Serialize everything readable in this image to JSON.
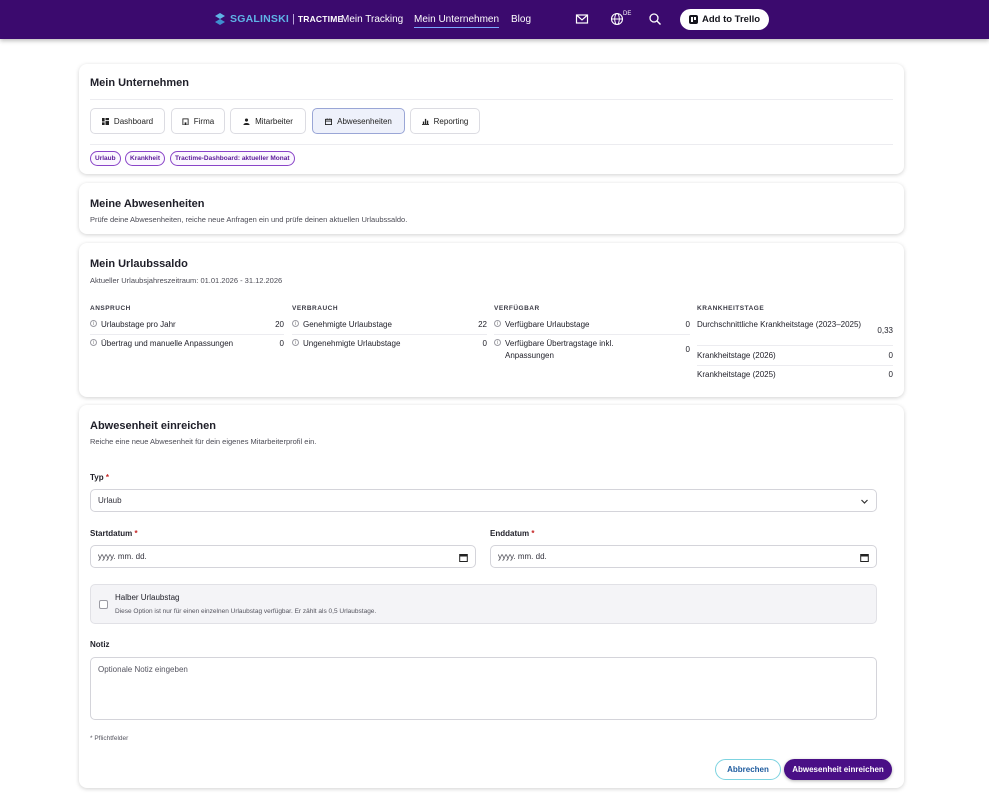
{
  "nav": {
    "brand_primary": "SGALINSKI",
    "brand_separator": "|",
    "brand_secondary": "TRACTIME",
    "links": [
      "Mein Tracking",
      "Mein Unternehmen",
      "Blog"
    ],
    "active_link": "Mein Unternehmen",
    "language_badge": "DE",
    "trello_button": "Add to Trello",
    "colors": {
      "bar": "#3b0a6e",
      "active_underline": "#7aa7ff",
      "brand_accent": "#5fb3e6"
    }
  },
  "company_card": {
    "title": "Mein Unternehmen",
    "tabs": [
      {
        "label": "Dashboard",
        "icon": "dashboard-icon"
      },
      {
        "label": "Firma",
        "icon": "building-icon"
      },
      {
        "label": "Mitarbeiter",
        "icon": "person-icon"
      },
      {
        "label": "Abwesenheiten",
        "icon": "calendar-icon",
        "active": true
      },
      {
        "label": "Reporting",
        "icon": "bar-chart-icon"
      }
    ],
    "chips": [
      "Urlaub",
      "Krankheit",
      "Tractime-Dashboard: aktueller Monat"
    ]
  },
  "absences_card": {
    "title": "Meine Abwesenheiten",
    "subtitle": "Prüfe deine Abwesenheiten, reiche neue Anfragen ein und prüfe deinen aktuellen Urlaubssaldo."
  },
  "saldo_card": {
    "title": "Mein Urlaubssaldo",
    "subtitle": "Aktueller Urlaubsjahreszeitraum: 01.01.2026 - 31.12.2026",
    "columns": [
      {
        "heading": "ANSPRUCH",
        "rows": [
          {
            "label": "Urlaubstage pro Jahr",
            "value": "20",
            "info": true
          },
          {
            "label": "Übertrag und manuelle Anpassungen",
            "value": "0",
            "info": true
          }
        ]
      },
      {
        "heading": "VERBRAUCH",
        "rows": [
          {
            "label": "Genehmigte Urlaubstage",
            "value": "22",
            "info": true
          },
          {
            "label": "Ungenehmigte Urlaubstage",
            "value": "0",
            "info": true
          }
        ]
      },
      {
        "heading": "VERFÜGBAR",
        "rows": [
          {
            "label": "Verfügbare Urlaubstage",
            "value": "0",
            "info": true
          },
          {
            "label": "Verfügbare Übertragstage inkl. Anpassungen",
            "value": "0",
            "info": true
          }
        ]
      },
      {
        "heading": "KRANKHEITSTAGE",
        "rows": [
          {
            "label": "Durchschnittliche Krankheitstage (2023–2025)",
            "value": "0,33",
            "info": false
          },
          {
            "label": "Krankheitstage (2026)",
            "value": "0",
            "info": false
          },
          {
            "label": "Krankheitstage (2025)",
            "value": "0",
            "info": false
          }
        ]
      }
    ]
  },
  "form": {
    "title": "Abwesenheit einreichen",
    "subtitle": "Reiche eine neue Abwesenheit für dein eigenes Mitarbeiterprofil ein.",
    "type_label": "Typ",
    "type_value": "Urlaub",
    "required_mark": "*",
    "start_label": "Startdatum",
    "start_placeholder": "yyyy. mm. dd.",
    "end_label": "Enddatum",
    "end_placeholder": "yyyy. mm. dd.",
    "halfday_title": "Halber Urlaubstag",
    "halfday_hint": "Diese Option ist nur für einen einzelnen Urlaubstag verfügbar. Er zählt als 0,5 Urlaubstage.",
    "note_label": "Notiz",
    "note_placeholder": "Optionale Notiz eingeben",
    "footnote": "* Pflichtfelder",
    "cancel_button": "Abbrechen",
    "submit_button": "Abwesenheit einreichen"
  }
}
